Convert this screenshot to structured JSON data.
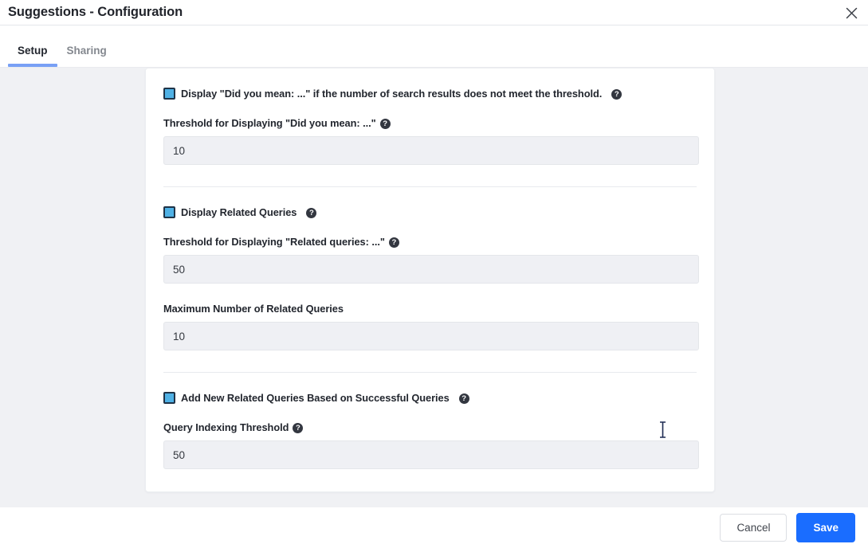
{
  "window": {
    "title": "Suggestions - Configuration",
    "close_icon": "close-icon"
  },
  "tabs": [
    {
      "label": "Setup",
      "active": true
    },
    {
      "label": "Sharing",
      "active": false
    }
  ],
  "colors": {
    "accent_blue": "#1a6dff",
    "tab_underline": "#78a0f5",
    "checkbox_fill": "#4fb1e5",
    "checkbox_border": "#1f3347",
    "page_background": "#f0f1f4",
    "card_background": "#ffffff",
    "input_background": "#eff0f4",
    "help_icon_background": "#333740"
  },
  "form": {
    "sections": [
      {
        "checkbox": {
          "label": "Display \"Did you mean: ...\" if the number of search results does not meet the threshold.",
          "checked": true,
          "help": "?"
        },
        "fields": [
          {
            "label": "Threshold for Displaying \"Did you mean: ...\"",
            "has_help": true,
            "help": "?",
            "value": "10",
            "placeholder": ""
          }
        ]
      },
      {
        "checkbox": {
          "label": "Display Related Queries",
          "checked": true,
          "help": "?"
        },
        "fields": [
          {
            "label": "Threshold for Displaying \"Related queries: ...\"",
            "has_help": true,
            "help": "?",
            "value": "50",
            "placeholder": ""
          },
          {
            "label": "Maximum Number of Related Queries",
            "has_help": false,
            "help": "",
            "value": "10",
            "placeholder": ""
          }
        ]
      },
      {
        "checkbox": {
          "label": "Add New Related Queries Based on Successful Queries",
          "checked": true,
          "help": "?"
        },
        "fields": [
          {
            "label": "Query Indexing Threshold",
            "has_help": true,
            "help": "?",
            "value": "50",
            "placeholder": ""
          }
        ]
      }
    ]
  },
  "footer": {
    "cancel_label": "Cancel",
    "save_label": "Save"
  }
}
